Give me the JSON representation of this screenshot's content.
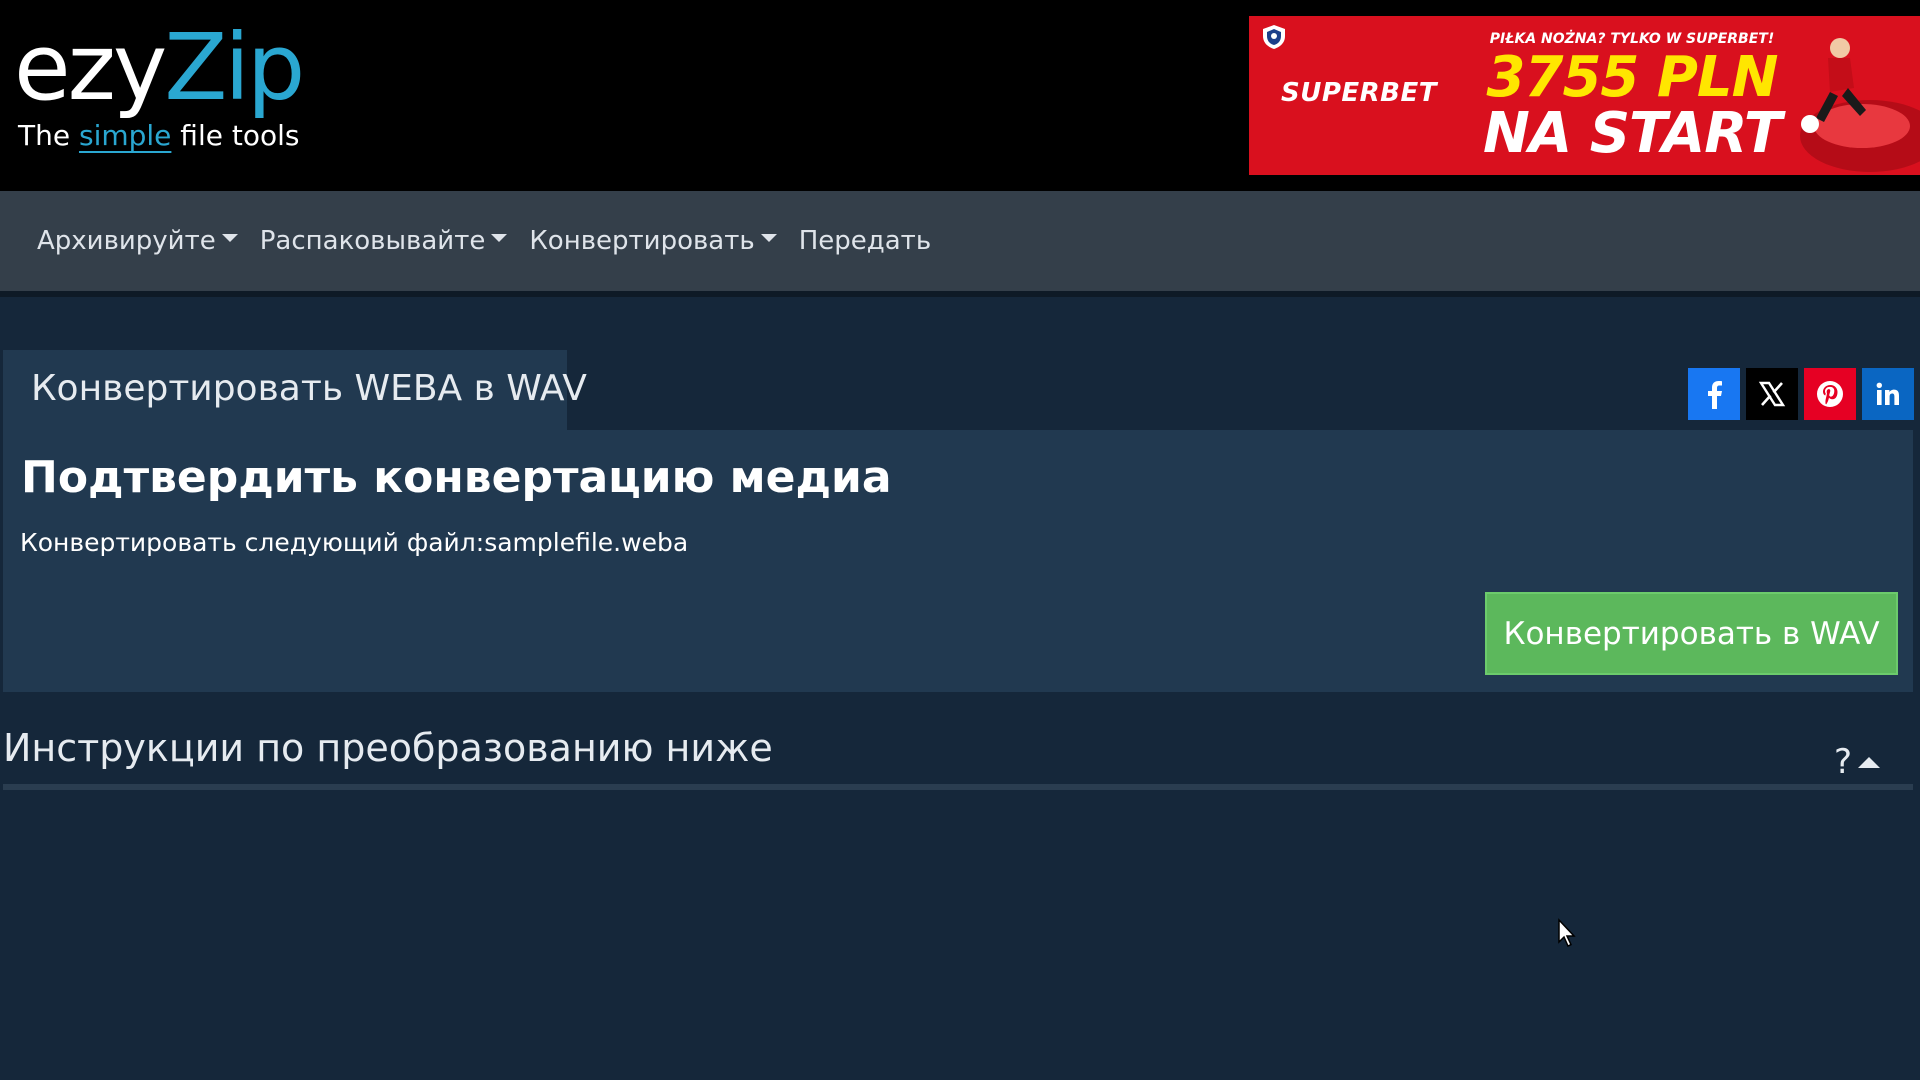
{
  "logo": {
    "name_part1": "ezy",
    "name_part2": "Zip",
    "tagline_before": "The ",
    "tagline_highlight": "simple",
    "tagline_after": " file tools"
  },
  "ad": {
    "brand": "SUPERBET",
    "headline": "PIŁKA NOŻNA? TYLKO W SUPERBET!",
    "amount": "3755 PLN",
    "cta": "NA START",
    "background_color": "#d9101e",
    "amount_color": "#ffe600"
  },
  "nav": {
    "items": [
      {
        "label": "Архивируйте",
        "has_dropdown": true
      },
      {
        "label": "Распаковывайте",
        "has_dropdown": true
      },
      {
        "label": "Конвертировать",
        "has_dropdown": true
      },
      {
        "label": "Передать",
        "has_dropdown": false
      }
    ]
  },
  "tool": {
    "tab_title": "Конвертировать WEBA в WAV",
    "heading": "Подтвердить конвертацию медиа",
    "file_line": "Конвертировать следующий файл:samplefile.weba",
    "convert_button": "Конвертировать в WAV"
  },
  "social": [
    {
      "name": "facebook",
      "icon": "facebook-icon",
      "color": "#1877f2"
    },
    {
      "name": "x",
      "icon": "x-icon",
      "color": "#000000"
    },
    {
      "name": "pinterest",
      "icon": "pinterest-icon",
      "color": "#e60023"
    },
    {
      "name": "linkedin",
      "icon": "linkedin-icon",
      "color": "#0a66c2"
    }
  ],
  "instructions": {
    "title": "Инструкции по преобразованию ниже",
    "help_symbol": "?"
  },
  "colors": {
    "accent": "#2aa7d1",
    "button_green": "#5cb85c",
    "page_bg": "#15273a",
    "card_bg": "#213950",
    "navbar_bg": "#343f4a"
  }
}
